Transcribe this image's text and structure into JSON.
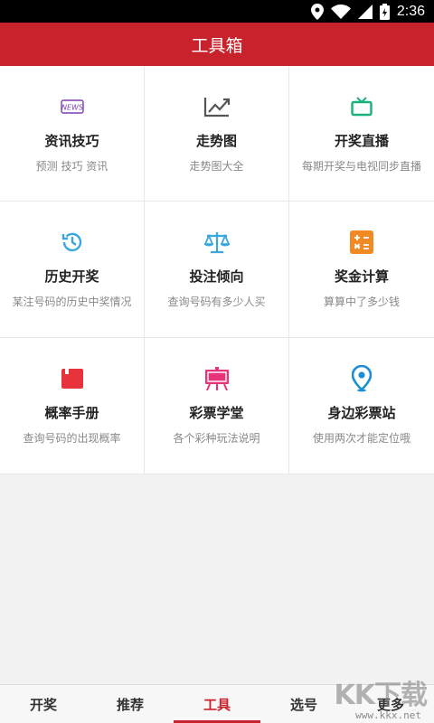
{
  "status_bar": {
    "time": "2:36"
  },
  "app_bar": {
    "title": "工具箱"
  },
  "tools": [
    {
      "label": "资讯技巧",
      "desc": "预测 技巧 资讯",
      "icon": "news-icon",
      "color": "#7b3fb5"
    },
    {
      "label": "走势图",
      "desc": "走势图大全",
      "icon": "trend-chart-icon",
      "color": "#555555"
    },
    {
      "label": "开奖直播",
      "desc": "每期开奖与电视同步直播",
      "icon": "tv-icon",
      "color": "#19b37a"
    },
    {
      "label": "历史开奖",
      "desc": "某注号码的历史中奖情况",
      "icon": "history-clock-icon",
      "color": "#3aa8e0"
    },
    {
      "label": "投注倾向",
      "desc": "查询号码有多少人买",
      "icon": "balance-scale-icon",
      "color": "#3aa8e0"
    },
    {
      "label": "奖金计算",
      "desc": "算算中了多少钱",
      "icon": "calculator-icon",
      "color": "#f08a24"
    },
    {
      "label": "概率手册",
      "desc": "查询号码的出现概率",
      "icon": "book-icon",
      "color": "#e8333c"
    },
    {
      "label": "彩票学堂",
      "desc": "各个彩种玩法说明",
      "icon": "easel-icon",
      "color": "#e8337a"
    },
    {
      "label": "身边彩票站",
      "desc": "使用两次才能定位哦",
      "icon": "location-pin-icon",
      "color": "#1a8fd6"
    }
  ],
  "bottom_nav": {
    "items": [
      {
        "label": "开奖",
        "active": false
      },
      {
        "label": "推荐",
        "active": false
      },
      {
        "label": "工具",
        "active": true
      },
      {
        "label": "选号",
        "active": false
      },
      {
        "label": "更多",
        "active": false
      }
    ]
  },
  "watermark": {
    "logo": "KK下载",
    "url": "www.kkx.net"
  },
  "colors": {
    "brand_red": "#c8232c"
  }
}
